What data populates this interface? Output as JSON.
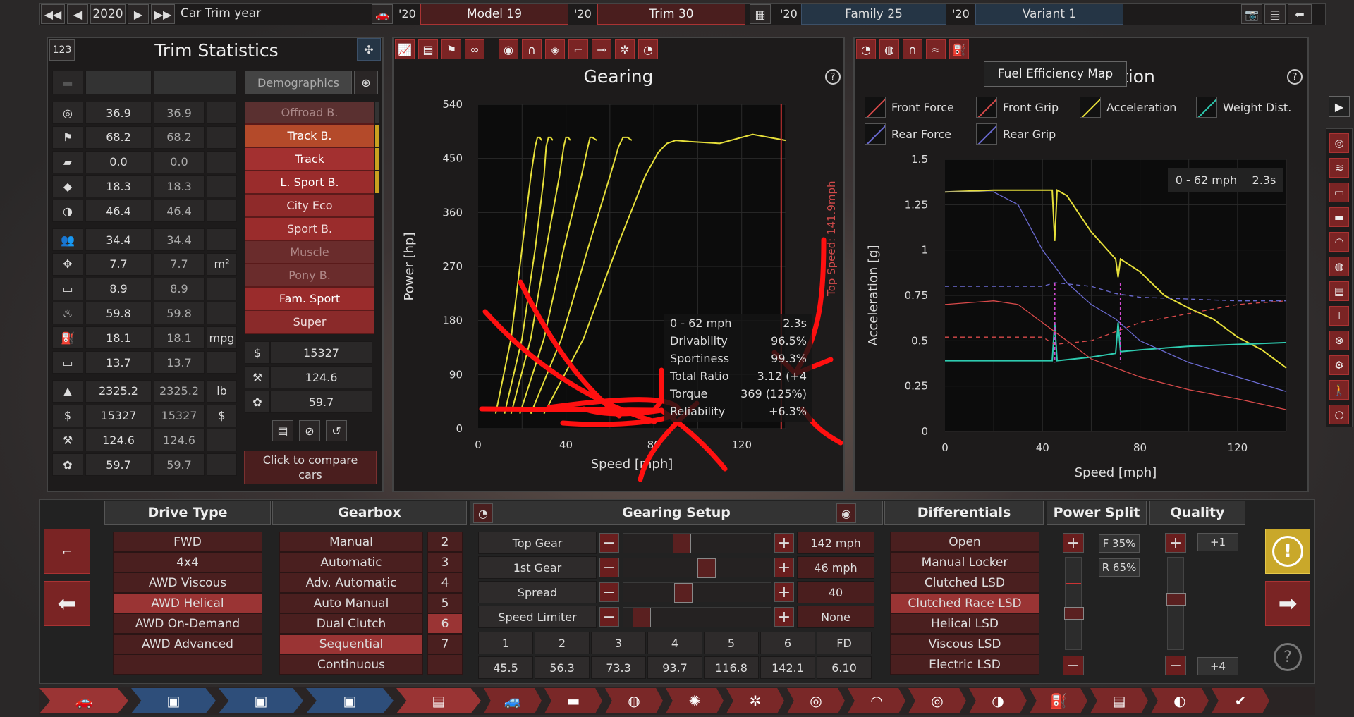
{
  "topbar": {
    "year": "2020",
    "year_label": "Car Trim year",
    "model_year": "'20",
    "model": "Model 19",
    "trim_year": "'20",
    "trim": "Trim 30",
    "family_year": "'20",
    "family": "Family 25",
    "variant_year": "'20",
    "variant": "Variant 1"
  },
  "trim_stats": {
    "title": "Trim Statistics",
    "badge": "123",
    "demographics_label": "Demographics",
    "compare_label": "Click to compare cars",
    "rows": [
      [
        "36.9",
        "36.9",
        ""
      ],
      [
        "68.2",
        "68.2",
        ""
      ],
      [
        "0.0",
        "0.0",
        ""
      ],
      [
        "18.3",
        "18.3",
        ""
      ],
      [
        "46.4",
        "46.4",
        ""
      ],
      [
        "34.4",
        "34.4",
        ""
      ],
      [
        "7.7",
        "7.7",
        "m²"
      ],
      [
        "8.9",
        "8.9",
        ""
      ],
      [
        "59.8",
        "59.8",
        ""
      ],
      [
        "18.1",
        "18.1",
        "mpg"
      ],
      [
        "13.7",
        "13.7",
        ""
      ],
      [
        "2325.2",
        "2325.2",
        "lb"
      ],
      [
        "15327",
        "15327",
        "$"
      ],
      [
        "124.6",
        "124.6",
        ""
      ],
      [
        "59.7",
        "59.7",
        ""
      ]
    ],
    "demographics": [
      "Offroad B.",
      "Track B.",
      "Track",
      "L. Sport B.",
      "City Eco",
      "Sport B.",
      "Muscle",
      "Pony B.",
      "Fam. Sport",
      "Super"
    ],
    "demo_stats": [
      "15327",
      "124.6",
      "59.7"
    ]
  },
  "gearing": {
    "title": "Gearing",
    "help": "?",
    "stats": [
      [
        "0 - 62 mph",
        "2.3s"
      ],
      [
        "Drivability",
        "96.5%"
      ],
      [
        "Sportiness",
        "99.3%"
      ],
      [
        "Total Ratio",
        "3.12 (+4"
      ],
      [
        "Torque",
        "369 (125%)"
      ],
      [
        "Reliability",
        "+6.3%"
      ]
    ],
    "top_speed": "Top Speed: 141.9mph"
  },
  "accel": {
    "title_tail": "tion",
    "tooltip": "Fuel Efficiency Map",
    "help": "?",
    "legend": [
      "Front Force",
      "Front Grip",
      "Acceleration",
      "Weight Dist.",
      "Rear Force",
      "Rear Grip"
    ],
    "stat_label": "0 - 62 mph",
    "stat_value": "2.3s"
  },
  "chart_data": [
    {
      "type": "line",
      "xlabel": "Speed [mph]",
      "ylabel": "Power [hp]",
      "xlim": [
        0,
        140
      ],
      "ylim": [
        0,
        540
      ],
      "xticks": [
        "0",
        "40",
        "80",
        "120"
      ],
      "yticks": [
        "0",
        "90",
        "180",
        "270",
        "360",
        "450",
        "540"
      ],
      "series": [
        {
          "x": [
            8,
            15,
            20,
            24,
            26,
            27,
            28,
            29
          ],
          "y": [
            25,
            150,
            300,
            420,
            470,
            485,
            485,
            480
          ]
        },
        {
          "x": [
            12,
            20,
            26,
            30,
            31,
            32,
            33,
            34
          ],
          "y": [
            25,
            150,
            300,
            420,
            470,
            485,
            485,
            480
          ]
        },
        {
          "x": [
            15,
            24,
            31,
            37,
            39,
            40,
            41,
            42
          ],
          "y": [
            25,
            150,
            300,
            420,
            470,
            485,
            485,
            480
          ]
        },
        {
          "x": [
            19,
            30,
            39,
            47,
            50,
            51,
            52,
            54
          ],
          "y": [
            25,
            150,
            300,
            420,
            470,
            485,
            485,
            480
          ]
        },
        {
          "x": [
            24,
            38,
            50,
            60,
            64,
            66,
            68,
            70
          ],
          "y": [
            25,
            150,
            300,
            420,
            470,
            485,
            485,
            480
          ]
        },
        {
          "x": [
            30,
            48,
            63,
            76,
            82,
            86,
            90,
            96,
            110,
            125,
            140
          ],
          "y": [
            25,
            150,
            300,
            420,
            460,
            475,
            480,
            478,
            475,
            490,
            480
          ]
        }
      ]
    },
    {
      "type": "line",
      "xlabel": "Speed [mph]",
      "ylabel": "Acceleration [g]",
      "xlim": [
        0,
        140
      ],
      "ylim": [
        0,
        1.5
      ],
      "xticks": [
        "0",
        "40",
        "80",
        "120"
      ],
      "yticks": [
        "0",
        "0.25",
        "0.5",
        "0.75",
        "1",
        "1.25",
        "1.5"
      ],
      "series": [
        {
          "name": "Acceleration",
          "x": [
            0,
            20,
            40,
            44,
            45,
            46,
            50,
            60,
            70,
            71,
            72,
            80,
            90,
            100,
            110,
            120,
            130,
            140
          ],
          "y": [
            1.32,
            1.33,
            1.33,
            1.33,
            1.05,
            1.33,
            1.3,
            1.1,
            0.95,
            0.85,
            0.95,
            0.88,
            0.75,
            0.68,
            0.62,
            0.52,
            0.45,
            0.35
          ]
        },
        {
          "name": "Weight Dist.",
          "x": [
            0,
            20,
            40,
            44,
            45,
            46,
            60,
            70,
            71,
            72,
            80,
            100,
            120,
            140
          ],
          "y": [
            0.39,
            0.39,
            0.39,
            0.39,
            0.6,
            0.39,
            0.41,
            0.43,
            0.6,
            0.44,
            0.45,
            0.47,
            0.48,
            0.49
          ]
        },
        {
          "name": "Front Force",
          "x": [
            0,
            20,
            30,
            40,
            50,
            60,
            70,
            80,
            100,
            120,
            140
          ],
          "y": [
            0.7,
            0.72,
            0.7,
            0.6,
            0.5,
            0.4,
            0.35,
            0.3,
            0.23,
            0.18,
            0.12
          ]
        },
        {
          "name": "Rear Force",
          "x": [
            0,
            20,
            30,
            40,
            50,
            60,
            70,
            80,
            100,
            120,
            140
          ],
          "y": [
            1.32,
            1.32,
            1.25,
            1.0,
            0.82,
            0.7,
            0.62,
            0.5,
            0.38,
            0.3,
            0.22
          ]
        },
        {
          "name": "Front Grip",
          "x": [
            0,
            40,
            45,
            60,
            70,
            80,
            100,
            120,
            140
          ],
          "y": [
            0.52,
            0.52,
            0.48,
            0.5,
            0.55,
            0.6,
            0.65,
            0.7,
            0.72
          ]
        },
        {
          "name": "Rear Grip",
          "x": [
            0,
            40,
            45,
            60,
            70,
            80,
            100,
            120,
            140
          ],
          "y": [
            0.8,
            0.8,
            0.82,
            0.8,
            0.76,
            0.74,
            0.73,
            0.72,
            0.72
          ]
        }
      ]
    }
  ],
  "bottom": {
    "drive_type": {
      "title": "Drive Type",
      "items": [
        "FWD",
        "4x4",
        "AWD Viscous",
        "AWD Helical",
        "AWD On-Demand",
        "AWD Advanced"
      ],
      "selected": 3
    },
    "gearbox": {
      "title": "Gearbox",
      "items": [
        "Manual",
        "Automatic",
        "Adv. Automatic",
        "Auto Manual",
        "Dual Clutch",
        "Sequential",
        "Continuous"
      ],
      "selected": 5,
      "gears": [
        "2",
        "3",
        "4",
        "5",
        "6",
        "7"
      ],
      "gear_selected": 4
    },
    "gearing_setup": {
      "title": "Gearing Setup",
      "rows": [
        [
          "Top Gear",
          "142 mph"
        ],
        [
          "1st Gear",
          "46 mph"
        ],
        [
          "Spread",
          "40"
        ],
        [
          "Speed Limiter",
          "None"
        ]
      ],
      "gear_headers": [
        "1",
        "2",
        "3",
        "4",
        "5",
        "6",
        "FD"
      ],
      "gear_values": [
        "45.5",
        "56.3",
        "73.3",
        "93.7",
        "116.8",
        "142.1",
        "6.10"
      ]
    },
    "differentials": {
      "title": "Differentials",
      "items": [
        "Open",
        "Manual Locker",
        "Clutched LSD",
        "Clutched Race LSD",
        "Helical LSD",
        "Viscous LSD",
        "Electric LSD"
      ],
      "selected": 3
    },
    "power_split": {
      "title": "Power Split",
      "front": "F 35%",
      "rear": "R 65%"
    },
    "quality": {
      "title": "Quality",
      "top": "+1",
      "bottom": "+4"
    }
  }
}
